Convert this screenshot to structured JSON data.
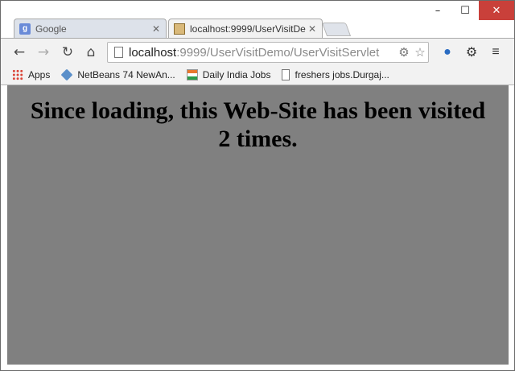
{
  "window_controls": {
    "minimize": "–",
    "maximize": "☐",
    "close": "✕"
  },
  "tabs": [
    {
      "title": "Google",
      "favicon_text": "g",
      "close": "✕",
      "active": false
    },
    {
      "title": "localhost:9999/UserVisitDe",
      "close": "✕",
      "active": true
    }
  ],
  "toolbar": {
    "back": "←",
    "forward": "→",
    "reload": "↻",
    "home": "⌂",
    "star": "☆",
    "settings": "⚙",
    "menu": "≡"
  },
  "address_bar": {
    "host": "localhost",
    "rest": ":9999/UserVisitDemo/UserVisitServlet"
  },
  "bookmarks": [
    {
      "label": "Apps"
    },
    {
      "label": "NetBeans 74 NewAn..."
    },
    {
      "label": "Daily India Jobs"
    },
    {
      "label": "freshers jobs.Durgaj..."
    }
  ],
  "page": {
    "line1": "Since loading, this Web-Site has been visited",
    "line2": "2 times."
  },
  "colors": {
    "page_background": "#808080",
    "close_button": "#c9403a"
  }
}
